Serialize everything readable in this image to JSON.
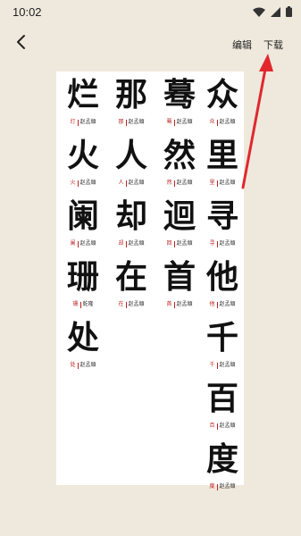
{
  "status": {
    "time": "10:02"
  },
  "topbar": {
    "edit_label": "编辑",
    "download_label": "下载"
  },
  "icons": {
    "back": "chevron-left-icon",
    "wifi": "wifi-icon",
    "signal": "signal-icon",
    "battery": "battery-icon"
  },
  "annotation": {
    "arrow_color": "#e0282e"
  },
  "sheet": {
    "columns": [
      [
        {
          "glyph": "烂",
          "char": "灯",
          "author": "赵孟頫"
        },
        {
          "glyph": "火",
          "char": "火",
          "author": "赵孟頫"
        },
        {
          "glyph": "阑",
          "char": "阑",
          "author": "赵孟頫"
        },
        {
          "glyph": "珊",
          "char": "珊",
          "author": "乾隆"
        },
        {
          "glyph": "处",
          "char": "处",
          "author": "赵孟頫"
        }
      ],
      [
        {
          "glyph": "那",
          "char": "那",
          "author": "赵孟頫"
        },
        {
          "glyph": "人",
          "char": "人",
          "author": "赵孟頫"
        },
        {
          "glyph": "却",
          "char": "却",
          "author": "赵孟頫"
        },
        {
          "glyph": "在",
          "char": "在",
          "author": "赵孟頫"
        }
      ],
      [
        {
          "glyph": "蓦",
          "char": "蓦",
          "author": "赵孟頫"
        },
        {
          "glyph": "然",
          "char": "然",
          "author": "赵孟頫"
        },
        {
          "glyph": "迴",
          "char": "回",
          "author": "赵孟頫"
        },
        {
          "glyph": "首",
          "char": "首",
          "author": "赵孟頫"
        }
      ],
      [
        {
          "glyph": "众",
          "char": "众",
          "author": "赵孟頫"
        },
        {
          "glyph": "里",
          "char": "里",
          "author": "赵孟頫"
        },
        {
          "glyph": "寻",
          "char": "寻",
          "author": "赵孟頫"
        },
        {
          "glyph": "他",
          "char": "他",
          "author": "赵孟頫"
        },
        {
          "glyph": "千",
          "char": "千",
          "author": "赵孟頫"
        },
        {
          "glyph": "百",
          "char": "百",
          "author": "赵孟頫"
        },
        {
          "glyph": "度",
          "char": "度",
          "author": "赵孟頫"
        }
      ]
    ]
  }
}
